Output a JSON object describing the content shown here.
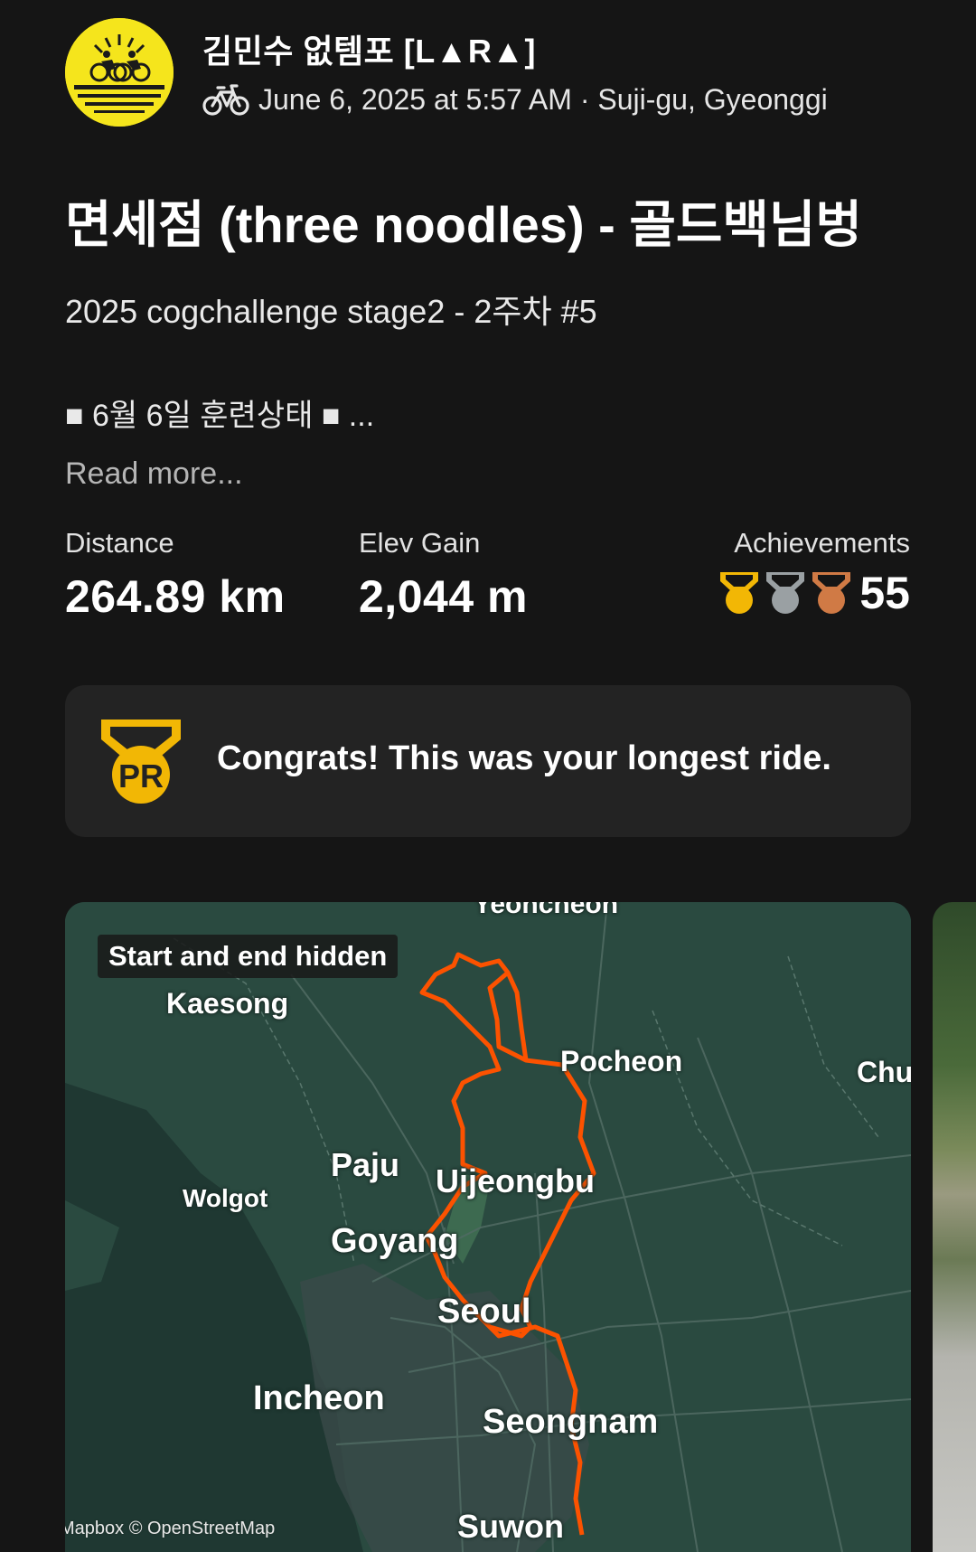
{
  "header": {
    "athlete_name": "김민수 없템포 [L▲R▲]",
    "activity_meta": "June 6, 2025 at 5:57 AM · Suji-gu, Gyeonggi",
    "activity_icon": "bike-icon"
  },
  "activity": {
    "title": "면세점 (three noodles) - 골드백님벙",
    "subtitle": "2025 cogchallenge stage2 - 2주차 #5",
    "description": "■ 6월 6일 훈련상태 ■  ...",
    "read_more": "Read more..."
  },
  "stats": {
    "distance_label": "Distance",
    "distance_value": "264.89 km",
    "elev_label": "Elev Gain",
    "elev_value": "2,044 m",
    "achievements_label": "Achievements",
    "achievements_count": "55",
    "medal_icons": [
      "gold-medal-icon",
      "silver-medal-icon",
      "bronze-medal-icon"
    ]
  },
  "pr_card": {
    "text": "Congrats! This was your longest ride.",
    "icon": "pr-medal-icon",
    "icon_text": "PR"
  },
  "map": {
    "badge": "Start and end hidden",
    "labels": [
      "Yeoncheon",
      "Kaesong",
      "Pocheon",
      "Chu",
      "Paju",
      "Uijeongbu",
      "Wolgot",
      "Goyang",
      "Seoul",
      "Incheon",
      "Seongnam",
      "Suwon"
    ],
    "attribution": "Mapbox © OpenStreetMap",
    "route_color": "#fc5200"
  },
  "colors": {
    "background": "#151515",
    "card": "#232323",
    "gold": "#f2b705",
    "silver": "#9aa0a3",
    "bronze": "#d07a45"
  }
}
